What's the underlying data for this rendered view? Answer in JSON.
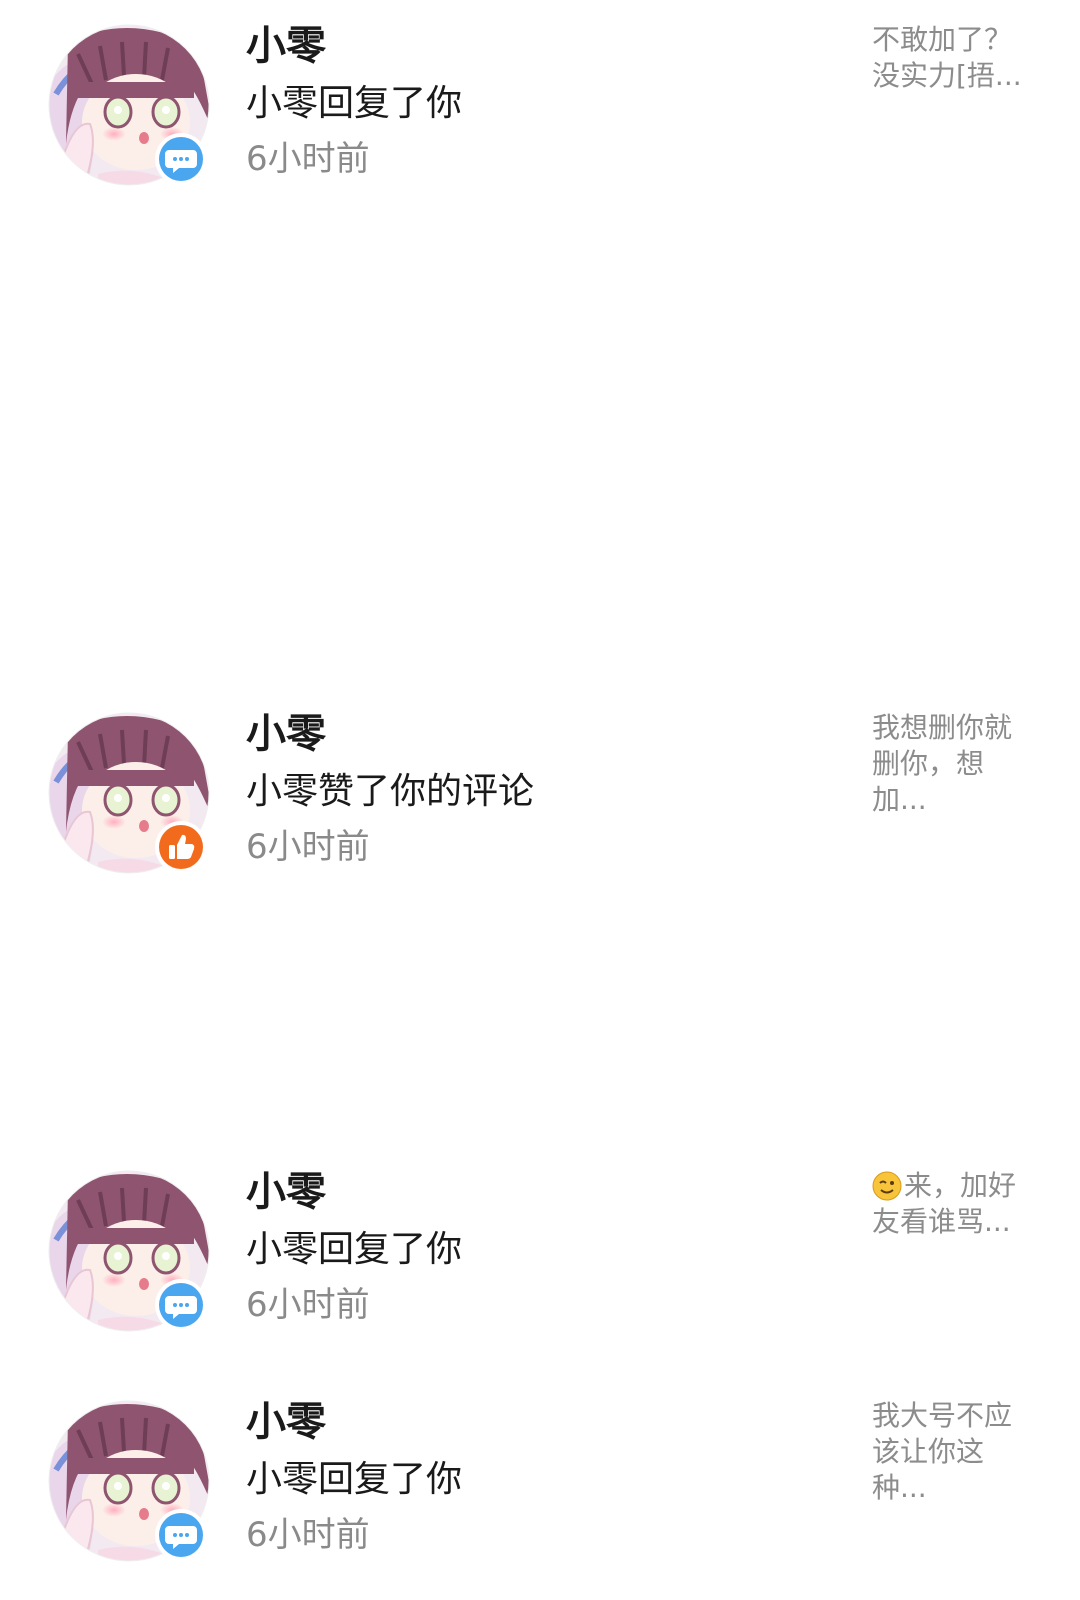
{
  "notifications": [
    {
      "name": "小零",
      "action": "小零回复了你",
      "time": "6小时前",
      "badge": "comment-badge-icon",
      "badge_color": "#4aa6ef",
      "preview": "不敢加了？没实力[捂..."
    },
    {
      "name": "小零",
      "action": "小零赞了你的评论",
      "time": "6小时前",
      "badge": "thumbs-up-badge-icon",
      "badge_color": "#f26b1d",
      "preview": "我想删你就删你，想加..."
    },
    {
      "name": "小零",
      "action": "小零回复了你",
      "time": "6小时前",
      "badge": "comment-badge-icon",
      "badge_color": "#4aa6ef",
      "preview_emoji": "wink-emoji-icon",
      "preview": "来，加好友看谁骂..."
    },
    {
      "name": "小零",
      "action": "小零回复了你",
      "time": "6小时前",
      "badge": "comment-badge-icon",
      "badge_color": "#4aa6ef",
      "preview": "我大号不应该让你这种..."
    }
  ]
}
